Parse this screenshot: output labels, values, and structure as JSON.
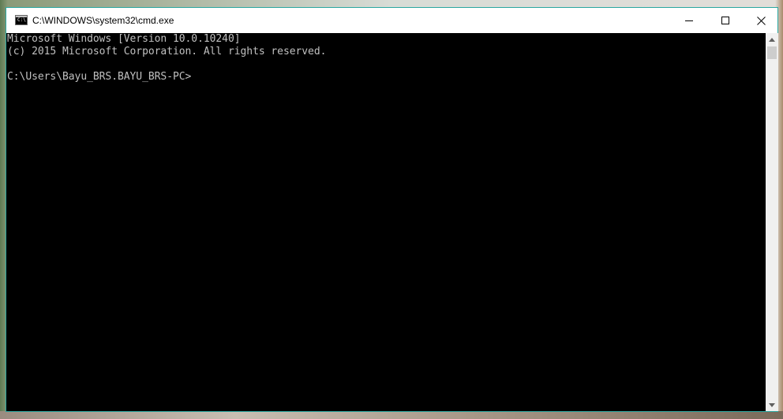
{
  "window": {
    "title": "C:\\WINDOWS\\system32\\cmd.exe",
    "icon": "console-icon",
    "controls": {
      "minimize_icon": "minimize-icon",
      "maximize_icon": "maximize-icon",
      "close_icon": "close-icon"
    }
  },
  "console": {
    "lines": [
      "Microsoft Windows [Version 10.0.10240]",
      "(c) 2015 Microsoft Corporation. All rights reserved.",
      "",
      "C:\\Users\\Bayu_BRS.BAYU_BRS-PC>"
    ],
    "background_color": "#000000",
    "text_color": "#c0c0c0"
  },
  "scrollbar": {
    "up_icon": "scroll-up-arrow-icon",
    "down_icon": "scroll-down-arrow-icon"
  },
  "colors": {
    "window_border": "#2aa7a0",
    "titlebar": "#ffffff"
  }
}
